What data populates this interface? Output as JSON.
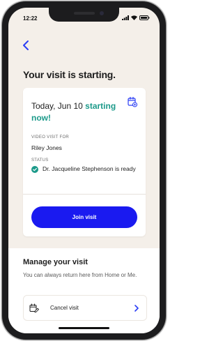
{
  "status_bar": {
    "time": "12:22"
  },
  "header": {
    "title": "Your visit is starting."
  },
  "visit_card": {
    "date": "Today, Jun 10",
    "date_status": "starting now!",
    "patient_label": "VIDEO VISIT FOR",
    "patient_name": "Riley Jones",
    "status_label": "STATUS",
    "status_text": "Dr. Jacqueline Stephenson is ready",
    "join_label": "Join visit"
  },
  "manage": {
    "title": "Manage your visit",
    "description": "You can always return here from Home or Me.",
    "cancel_label": "Cancel visit"
  },
  "colors": {
    "accent_teal": "#1c9a8a",
    "primary_button": "#1a1af0",
    "background": "#f4efe9",
    "link_blue": "#2a3df5"
  },
  "icons": {
    "back": "chevron-left-icon",
    "calendar": "calendar-add-icon",
    "status": "check-circle-icon",
    "cancel": "calendar-edit-icon",
    "forward": "chevron-right-icon"
  }
}
